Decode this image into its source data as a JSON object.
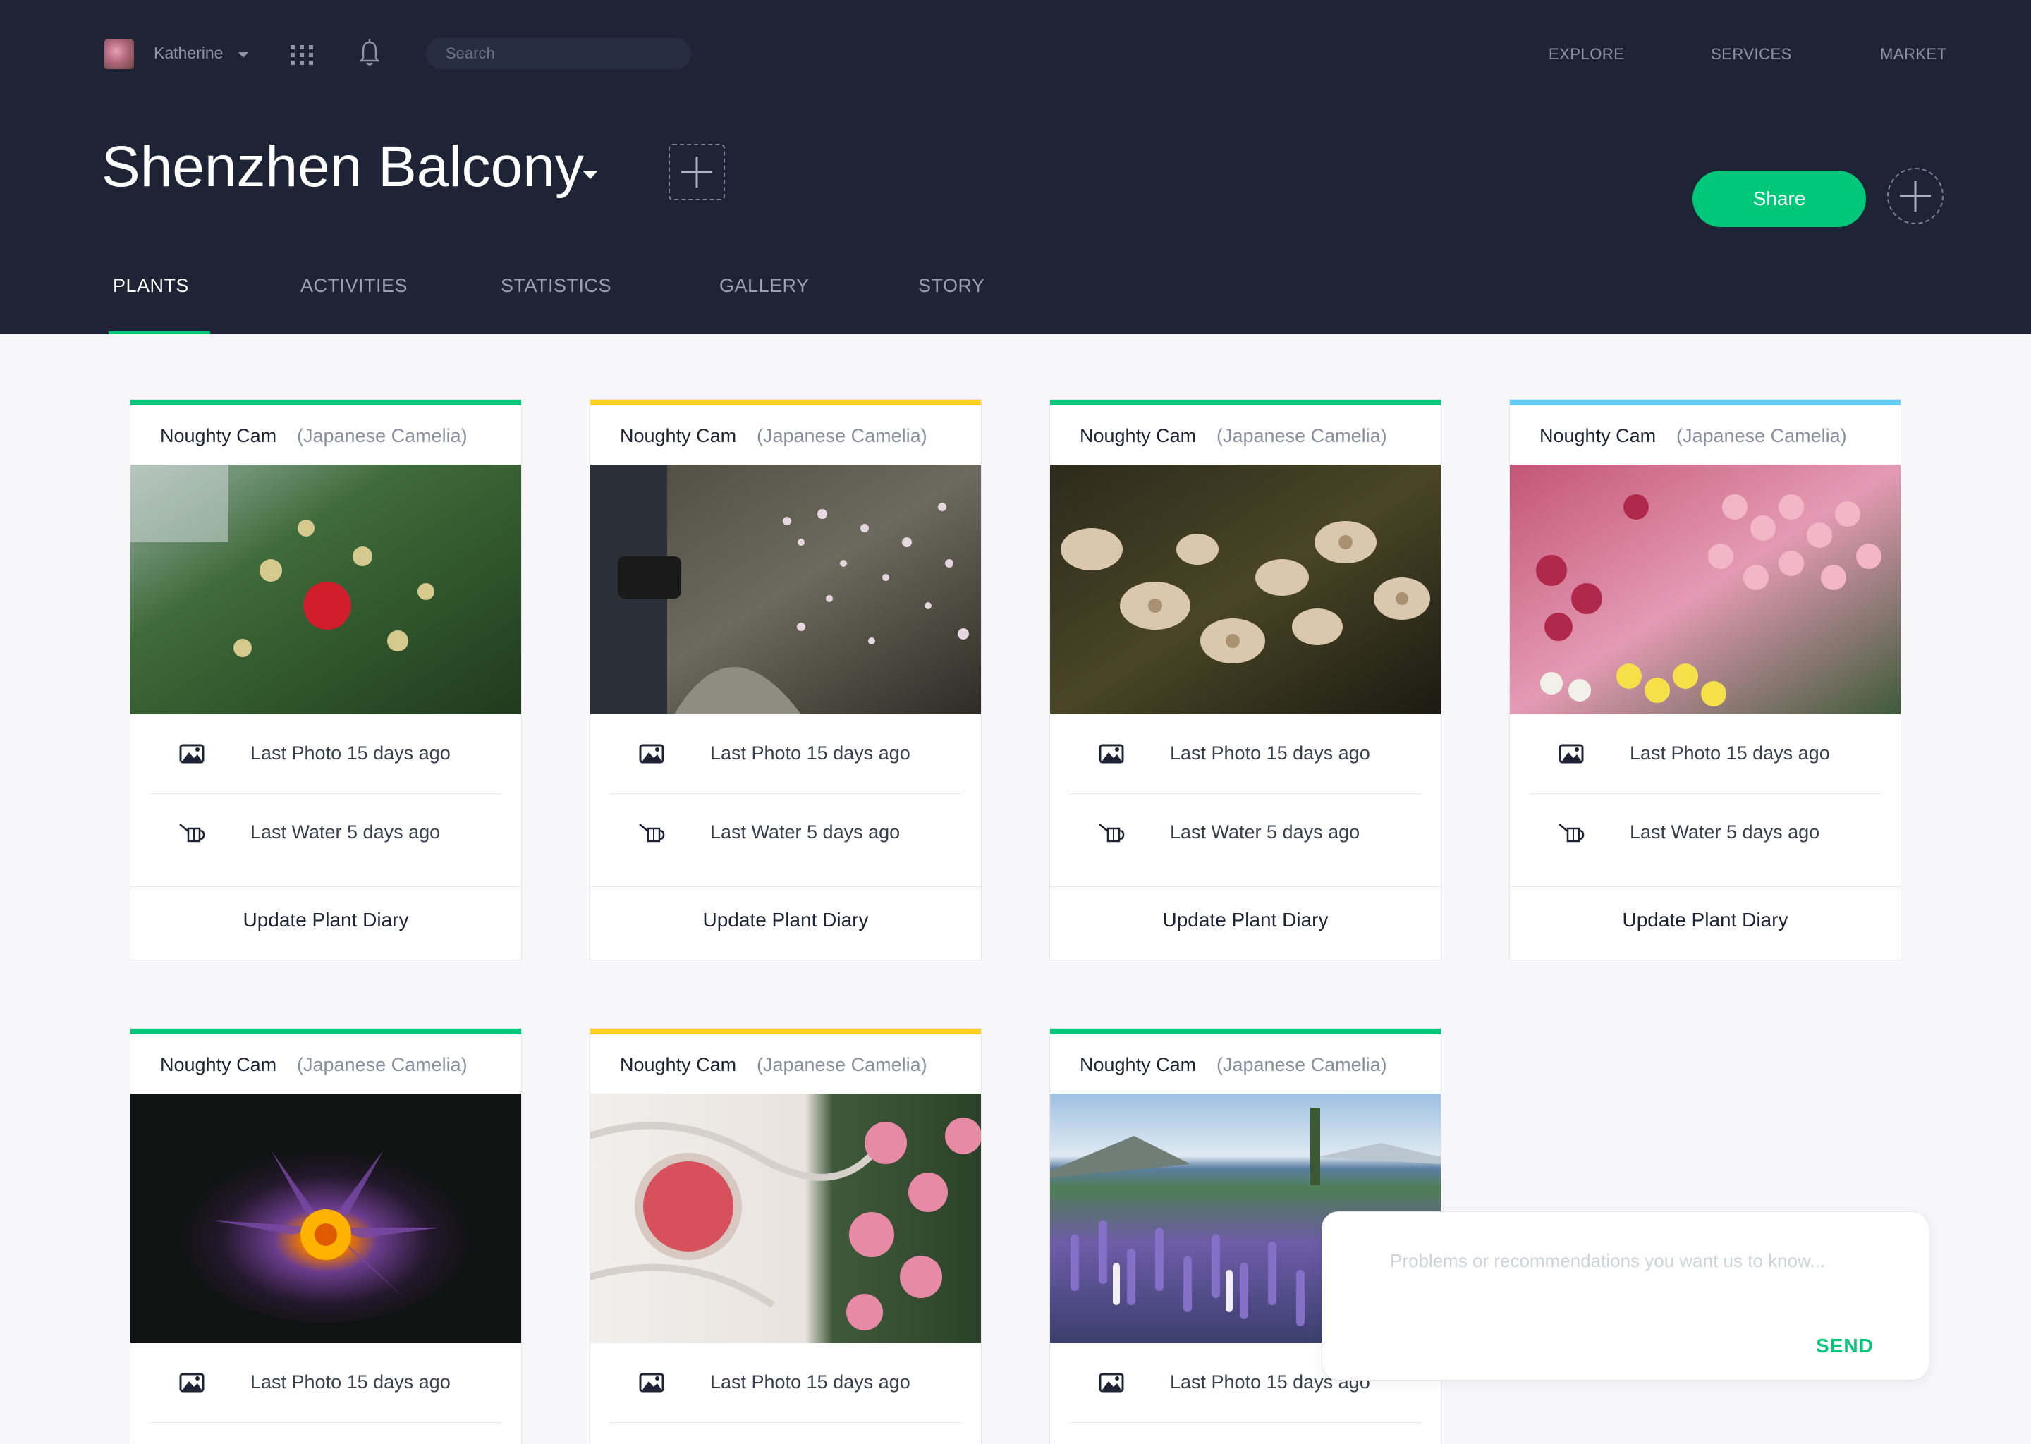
{
  "user": {
    "name": "Katherine"
  },
  "search": {
    "placeholder": "Search"
  },
  "topnav": [
    "EXPLORE",
    "SERVICES",
    "MARKET"
  ],
  "page": {
    "title": "Shenzhen Balcony",
    "share_label": "Share"
  },
  "tabs": [
    {
      "label": "PLANTS",
      "active": true
    },
    {
      "label": "ACTIVITIES",
      "active": false
    },
    {
      "label": "STATISTICS",
      "active": false
    },
    {
      "label": "GALLERY",
      "active": false
    },
    {
      "label": "STORY",
      "active": false
    }
  ],
  "cards": [
    {
      "name": "Noughty Cam",
      "species": "(Japanese Camelia)",
      "accent": "#00c77a",
      "photo": "camellia-red-flower-bush",
      "last_photo": "Last Photo 15 days ago",
      "last_water": "Last Water 5 days ago",
      "action": "Update Plant Diary"
    },
    {
      "name": "Noughty Cam",
      "species": "(Japanese Camelia)",
      "accent": "#ffd21f",
      "photo": "pink-blossom-branch",
      "last_photo": "Last Photo 15 days ago",
      "last_water": "Last Water 5 days ago",
      "action": "Update Plant Diary"
    },
    {
      "name": "Noughty Cam",
      "species": "(Japanese Camelia)",
      "accent": "#00c77a",
      "photo": "dried-white-flowers",
      "last_photo": "Last Photo 15 days ago",
      "last_water": "Last Water 5 days ago",
      "action": "Update Plant Diary"
    },
    {
      "name": "Noughty Cam",
      "species": "(Japanese Camelia)",
      "accent": "#66ccf4",
      "photo": "tulip-bouquets",
      "last_photo": "Last Photo 15 days ago",
      "last_water": "Last Water 5 days ago",
      "action": "Update Plant Diary"
    },
    {
      "name": "Noughty Cam",
      "species": "(Japanese Camelia)",
      "accent": "#00c77a",
      "photo": "purple-water-lily",
      "last_photo": "Last Photo 15 days ago"
    },
    {
      "name": "Noughty Cam",
      "species": "(Japanese Camelia)",
      "accent": "#ffd21f",
      "photo": "pink-peonies-smoothie",
      "last_photo": "Last Photo 15 days ago"
    },
    {
      "name": "Noughty Cam",
      "species": "(Japanese Camelia)",
      "accent": "#00c77a",
      "photo": "lupine-field-lake",
      "last_photo": "Last Photo 15 days ago"
    }
  ],
  "feedback": {
    "placeholder": "Problems or recommendations you want us to know...",
    "send_label": "SEND"
  },
  "colors": {
    "header_bg": "#1e2435",
    "brand_green": "#00c77a",
    "accent_yellow": "#ffd21f",
    "accent_blue": "#66ccf4"
  }
}
